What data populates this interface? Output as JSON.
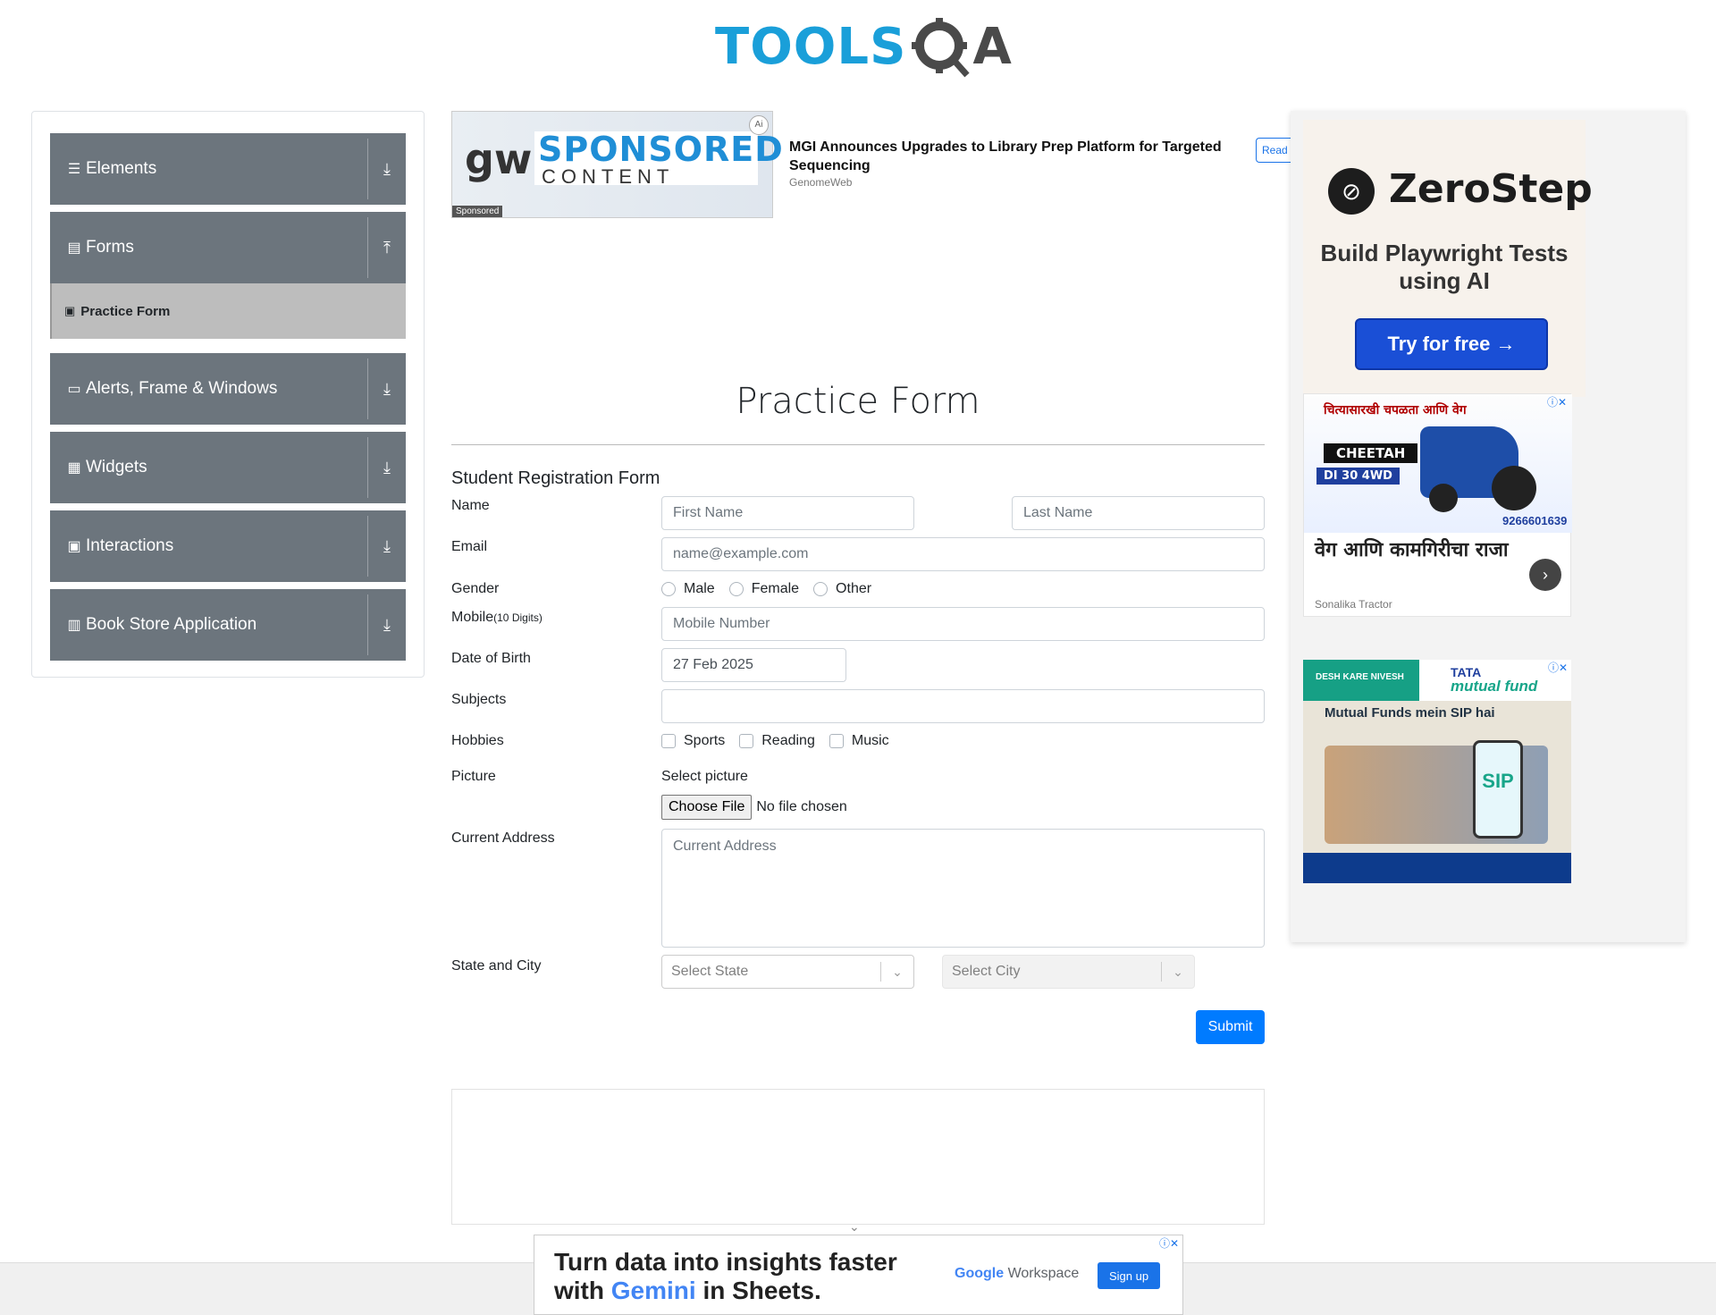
{
  "logo": {
    "left": "TOOLS",
    "right": "A"
  },
  "sidebar": {
    "groups": [
      {
        "icon": "☰",
        "label": "Elements",
        "arrow": "⤓"
      },
      {
        "icon": "▤",
        "label": "Forms",
        "arrow": "⤒",
        "subitems": [
          {
            "icon": "▣",
            "label": "Practice Form"
          }
        ]
      },
      {
        "icon": "▭",
        "label": "Alerts, Frame & Windows",
        "arrow": "⤓"
      },
      {
        "icon": "▦",
        "label": "Widgets",
        "arrow": "⤓"
      },
      {
        "icon": "▣",
        "label": "Interactions",
        "arrow": "⤓"
      },
      {
        "icon": "▥",
        "label": "Book Store Application",
        "arrow": "⤓"
      }
    ]
  },
  "ad_top": {
    "brand": "gw",
    "sponsored_big": "SPONSORED",
    "sponsored_small": "CONTENT",
    "ai": "Ai",
    "tag": "Sponsored",
    "headline": "MGI Announces Upgrades to Library Prep Platform for Targeted Sequencing",
    "source": "GenomeWeb",
    "read": "Read m"
  },
  "form": {
    "page_title": "Practice Form",
    "heading": "Student Registration Form",
    "name_label": "Name",
    "first_name_placeholder": "First Name",
    "last_name_placeholder": "Last Name",
    "email_label": "Email",
    "email_placeholder": "name@example.com",
    "gender_label": "Gender",
    "genders": [
      "Male",
      "Female",
      "Other"
    ],
    "mobile_label": "Mobile",
    "mobile_hint": "(10 Digits)",
    "mobile_placeholder": "Mobile Number",
    "dob_label": "Date of Birth",
    "dob_value": "27 Feb 2025",
    "subjects_label": "Subjects",
    "hobbies_label": "Hobbies",
    "hobbies": [
      "Sports",
      "Reading",
      "Music"
    ],
    "picture_label": "Picture",
    "select_picture": "Select picture",
    "choose_file": "Choose File",
    "no_file": "No file chosen",
    "address_label": "Current Address",
    "address_placeholder": "Current Address",
    "state_city_label": "State and City",
    "state_placeholder": "Select State",
    "city_placeholder": "Select City",
    "submit": "Submit"
  },
  "right_ads": {
    "zerostep": {
      "brand": "ZeroStep",
      "tagline": "Build Playwright Tests using AI",
      "cta": "Try for free →"
    },
    "tractor": {
      "top_text": "चित्यासारखी चपळता आणि वेग",
      "model_name": "CHEETAH",
      "model": "DI 30 4WD",
      "phone": "9266601639",
      "headline": "वेग आणि कामगिरीचा राजा",
      "source": "Sonalika Tractor"
    },
    "tata": {
      "left_badge": "DESH KARE NIVESH",
      "brand": "TATA",
      "brand_sub": "mutual fund",
      "copy": "Mutual Funds mein SIP hai",
      "phone_text": "SIP"
    }
  },
  "bottom_banner": {
    "line1": "Turn data into insights faster",
    "line2_pre": "with ",
    "line2_gem": "Gemini",
    "line2_post": " in Sheets.",
    "google": "Google",
    "workspace": "Workspace",
    "signup": "Sign up"
  }
}
